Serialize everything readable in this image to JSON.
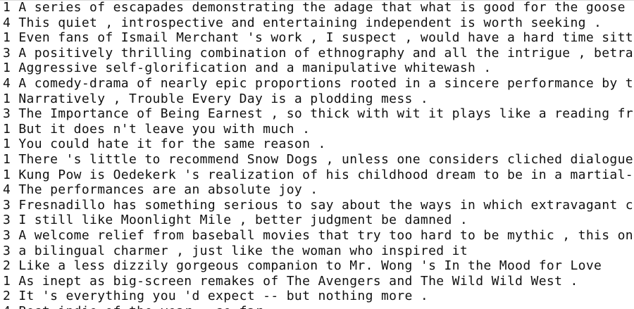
{
  "document": {
    "lines": [
      {
        "label": "1",
        "text": "A series of escapades demonstrating the adage that what is good for the goose"
      },
      {
        "label": "4",
        "text": "This quiet , introspective and entertaining independent is worth seeking ."
      },
      {
        "label": "1",
        "text": "Even fans of Ismail Merchant 's work , I suspect , would have a hard time sitting through this one ."
      },
      {
        "label": "3",
        "text": "A positively thrilling combination of ethnography and all the intrigue , betrayal , deceit and murder"
      },
      {
        "label": "1",
        "text": "Aggressive self-glorification and a manipulative whitewash ."
      },
      {
        "label": "4",
        "text": "A comedy-drama of nearly epic proportions rooted in a sincere performance by the title character"
      },
      {
        "label": "1",
        "text": "Narratively , Trouble Every Day is a plodding mess ."
      },
      {
        "label": "3",
        "text": "The Importance of Being Earnest , so thick with wit it plays like a reading from Bartlett 's"
      },
      {
        "label": "1",
        "text": "But it does n't leave you with much ."
      },
      {
        "label": "1",
        "text": "You could hate it for the same reason ."
      },
      {
        "label": "1",
        "text": "There 's little to recommend Snow Dogs , unless one considers cliched dialogue"
      },
      {
        "label": "1",
        "text": "Kung Pow is Oedekerk 's realization of his childhood dream to be in a martial-arts flick"
      },
      {
        "label": "4",
        "text": "The performances are an absolute joy ."
      },
      {
        "label": "3",
        "text": "Fresnadillo has something serious to say about the ways in which extravagant chance"
      },
      {
        "label": "3",
        "text": "I still like Moonlight Mile , better judgment be damned ."
      },
      {
        "label": "3",
        "text": "A welcome relief from baseball movies that try too hard to be mythic , this one"
      },
      {
        "label": "3",
        "text": "a bilingual charmer , just like the woman who inspired it"
      },
      {
        "label": "2",
        "text": "Like a less dizzily gorgeous companion to Mr. Wong 's In the Mood for Love"
      },
      {
        "label": "1",
        "text": "As inept as big-screen remakes of The Avengers and The Wild Wild West ."
      },
      {
        "label": "2",
        "text": "It 's everything you 'd expect -- but nothing more ."
      },
      {
        "label": "4",
        "text": "Best indie of the year , so far ."
      }
    ]
  }
}
